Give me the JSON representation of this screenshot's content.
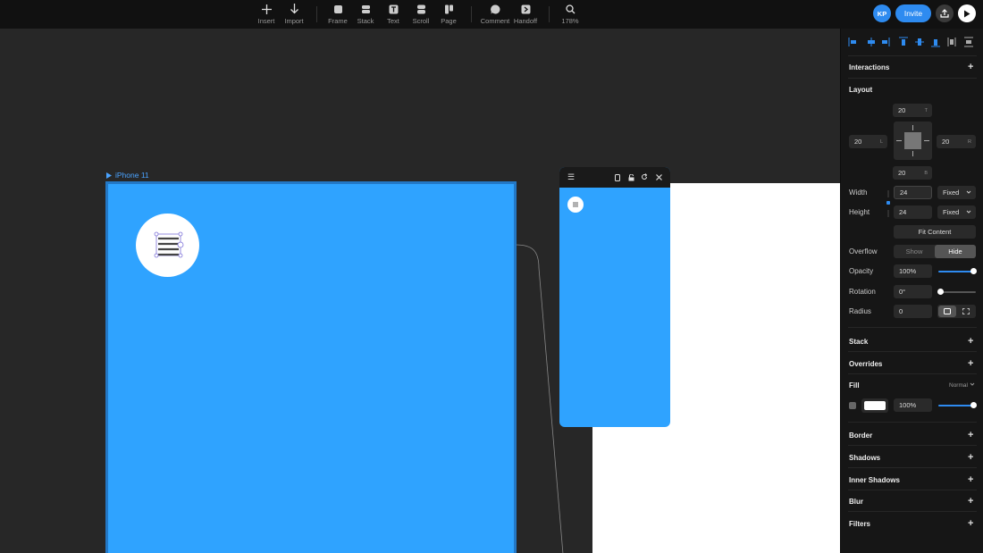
{
  "toolbar": {
    "tools": [
      {
        "label": "Insert",
        "icon": "plus-icon"
      },
      {
        "label": "Import",
        "icon": "arrow-down-icon"
      },
      {
        "label": "Frame",
        "icon": "frame-icon"
      },
      {
        "label": "Stack",
        "icon": "stack-icon"
      },
      {
        "label": "Text",
        "icon": "text-icon"
      },
      {
        "label": "Scroll",
        "icon": "scroll-icon"
      },
      {
        "label": "Page",
        "icon": "page-icon"
      },
      {
        "label": "Comment",
        "icon": "comment-icon"
      },
      {
        "label": "Handoff",
        "icon": "handoff-icon"
      },
      {
        "label": "178%",
        "icon": "search-icon"
      }
    ],
    "avatar_initials": "KP",
    "invite_label": "Invite"
  },
  "canvas": {
    "frame_label": "iPhone 11",
    "frame_color": "#2fa3ff"
  },
  "panel": {
    "interactions": "Interactions",
    "layout": "Layout",
    "padding": {
      "top": "20",
      "top_suffix": "T",
      "left": "20",
      "left_suffix": "L",
      "right": "20",
      "right_suffix": "R",
      "bottom": "20",
      "bottom_suffix": "B"
    },
    "width_label": "Width",
    "width_value": "24",
    "width_mode": "Fixed",
    "height_label": "Height",
    "height_value": "24",
    "height_mode": "Fixed",
    "fit_content": "Fit Content",
    "overflow_label": "Overflow",
    "overflow_show": "Show",
    "overflow_hide": "Hide",
    "opacity_label": "Opacity",
    "opacity_value": "100%",
    "opacity_level": 1.0,
    "rotation_label": "Rotation",
    "rotation_value": "0°",
    "radius_label": "Radius",
    "radius_value": "0",
    "stack": "Stack",
    "overrides": "Overrides",
    "fill": "Fill",
    "fill_blend": "Normal",
    "fill_opacity": "100%",
    "border": "Border",
    "shadows": "Shadows",
    "inner_shadows": "Inner Shadows",
    "blur": "Blur",
    "filters": "Filters"
  }
}
